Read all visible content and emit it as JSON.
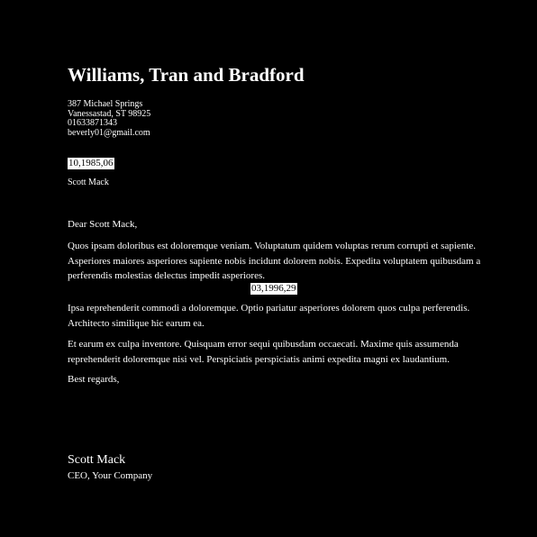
{
  "letter": {
    "company_name": "Williams, Tran and Bradford",
    "address": {
      "street": "387 Michael Springs",
      "city_line": "Vanessastad, ST 98925",
      "phone": "01633871343",
      "email": "beverly01@gmail.com"
    },
    "date_top": "10,1985,06",
    "recipient_name": "Scott Mack",
    "salutation": "Dear Scott Mack,",
    "paragraphs": [
      "Quos ipsam doloribus est doloremque veniam. Voluptatum quidem voluptas rerum corrupti et sapiente. Asperiores maiores asperiores sapiente nobis incidunt dolorem nobis. Expedita voluptatem quibusdam a perferendis molestias delectus impedit asperiores.",
      "Ipsa reprehenderit commodi a doloremque. Optio pariatur asperiores dolorem quos culpa perferendis. Architecto similique hic earum ea.",
      "Et earum ex culpa inventore. Quisquam error sequi quibusdam occaecati. Maxime quis assumenda reprehenderit doloremque nisi vel. Perspiciatis perspiciatis animi expedita magni ex laudantium."
    ],
    "date_inline": "03,1996,29",
    "closing": "Best regards,",
    "signature_name": "Scott Mack",
    "signature_title": "CEO, Your Company"
  },
  "colors": {
    "background": "#000000",
    "text": "#ffffff",
    "highlight_bg": "#ffffff",
    "highlight_text": "#000000"
  }
}
